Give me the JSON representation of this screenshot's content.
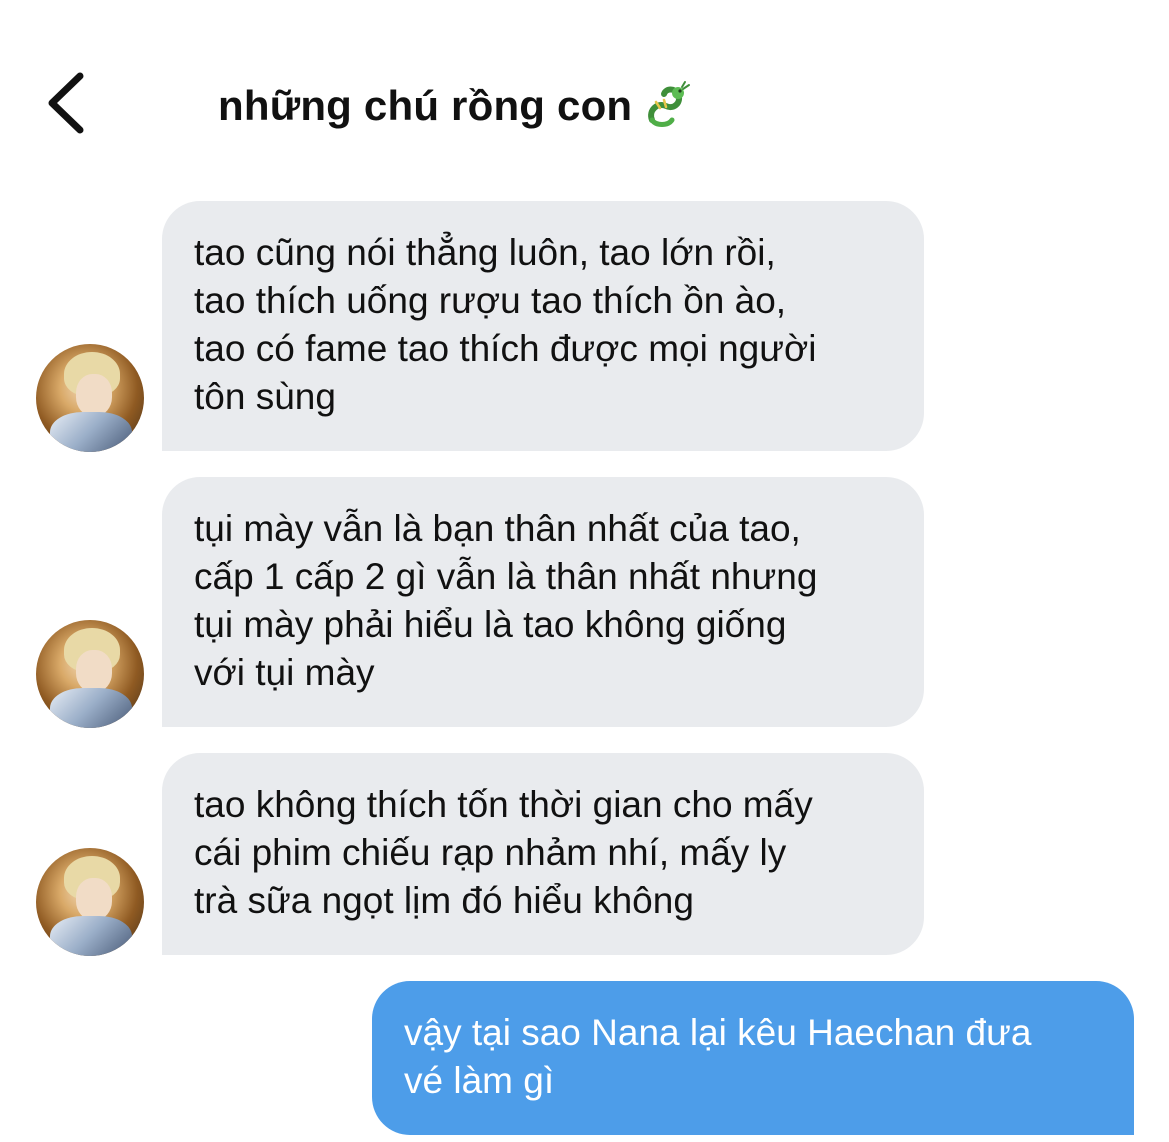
{
  "header": {
    "back_icon": "chevron-left-icon",
    "title": "những chú rồng con",
    "title_emoji_icon": "dragon-icon"
  },
  "messages": [
    {
      "direction": "incoming",
      "avatar_icon": "user-avatar",
      "text": "tao cũng nói thẳng luôn, tao lớn rồi,\ntao thích uống rượu tao thích ồn ào,\ntao có fame tao thích được mọi người\ntôn sùng"
    },
    {
      "direction": "incoming",
      "avatar_icon": "user-avatar",
      "text": "tụi mày vẫn là bạn thân nhất của tao,\ncấp 1 cấp 2 gì vẫn là thân nhất nhưng\ntụi mày phải hiểu là tao không giống\nvới tụi mày"
    },
    {
      "direction": "incoming",
      "avatar_icon": "user-avatar",
      "text": "tao không thích tốn thời gian cho mấy\ncái phim chiếu rạp nhảm nhí, mấy ly\ntrà sữa ngọt lịm đó hiểu không"
    },
    {
      "direction": "outgoing",
      "text": "vậy tại sao Nana lại kêu Haechan đưa\nvé làm gì"
    }
  ],
  "colors": {
    "incoming_bubble": "#e9ebee",
    "outgoing_bubble": "#4d9de9",
    "background": "#ffffff",
    "text": "#111111"
  }
}
